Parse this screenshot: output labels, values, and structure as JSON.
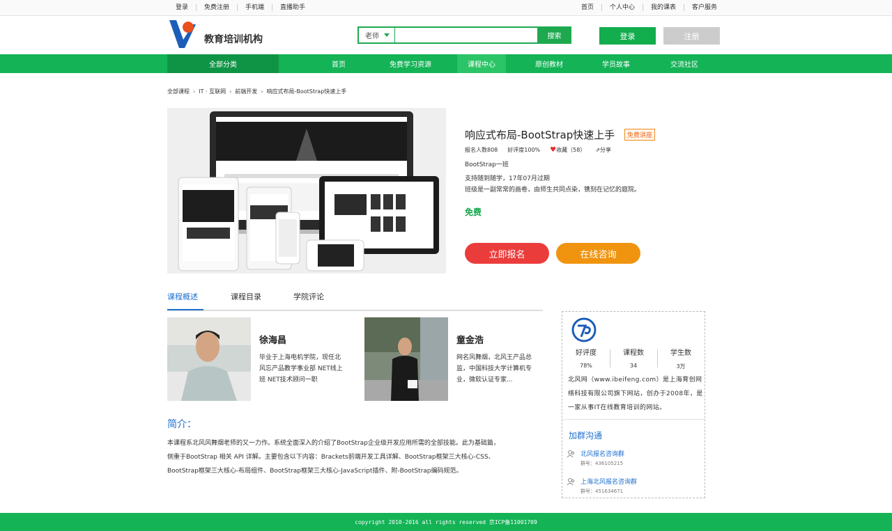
{
  "topbar": {
    "left": [
      "登录",
      "免费注册",
      "手机端",
      "直播助手"
    ],
    "right": [
      "首页",
      "个人中心",
      "我的课表",
      "客户服务"
    ]
  },
  "header": {
    "logo_text": "教育培训机构",
    "search_scope": "老师",
    "search_value": "",
    "search_button": "搜索",
    "login_button": "登录",
    "register_button": "注册"
  },
  "nav": {
    "all_categories": "全部分类",
    "items": [
      "首页",
      "免费学习资源",
      "课程中心",
      "原创教材",
      "学员故事",
      "交流社区"
    ],
    "active_index": 2
  },
  "breadcrumb": [
    "全部课程",
    "IT · 互联网",
    "前端开发",
    "响应式布局-BootStrap快速上手"
  ],
  "course": {
    "title": "响应式布局-BootStrap快速上手",
    "tag": "免费讲座",
    "enrolled": "报名人数808",
    "rating": "好评度100%",
    "favorite": "收藏（58）",
    "share": "分享",
    "class_name": "BootStrap一班",
    "schedule": "支持随到随学，17年07月过期",
    "slogan": "班级是一副常常的画卷，由师生共同点染，镌刻在记忆的庭院。",
    "price": "免费",
    "enroll_button": "立即报名",
    "consult_button": "在线咨询"
  },
  "tabs": [
    "课程概述",
    "课程目录",
    "学院评论"
  ],
  "teachers": [
    {
      "name": "徐海昌",
      "bio": "毕业于上海电机学院，现任北风忘产品教学事业部 NET线上班 NET技术顾问一职"
    },
    {
      "name": "童金浩",
      "bio": "网名风舞烟，北风王产品总监，中国科技大学计算机专业，微软认证专家..."
    }
  ],
  "intro": {
    "title": "简介：",
    "lines": [
      "本课程系北风风舞烟老师的又一力作。系统全面深入的介绍了BootStrap企业级开发应用所需的全部技能。此为基础篇，",
      "侧重于BootStrap 相关 API 详解。主要包含以下内容：Brackets前端开发工具详解、BootStrap框架三大核心-CSS、",
      "BootStrap框架三大核心-布局组件、BootStrap框架三大核心-JavaScript插件、附-BootStrap编码规范。"
    ]
  },
  "sidebar": {
    "stats": [
      {
        "label": "好评度",
        "value": "78%"
      },
      {
        "label": "课程数",
        "value": "34"
      },
      {
        "label": "学生数",
        "value": "3万"
      }
    ],
    "description": "北风网（www.ibeifeng.com）是上海育创网络科技有限公司旗下网站，创办于2008年，是一家从事IT在线教育培训的网站。",
    "group_title": "加群沟通",
    "groups": [
      {
        "name": "北风报名咨询群",
        "number": "群号：436105215"
      },
      {
        "name": "上海北风报名咨询群",
        "number": "群号：451634671"
      }
    ]
  },
  "footer": "copyright 2010-2016  all rights reserved 京ICP备11001709",
  "colors": {
    "brand_green": "#13b356",
    "accent_blue": "#1e6fcf",
    "enroll_red": "#eb3c3c",
    "consult_orange": "#f0940f"
  }
}
